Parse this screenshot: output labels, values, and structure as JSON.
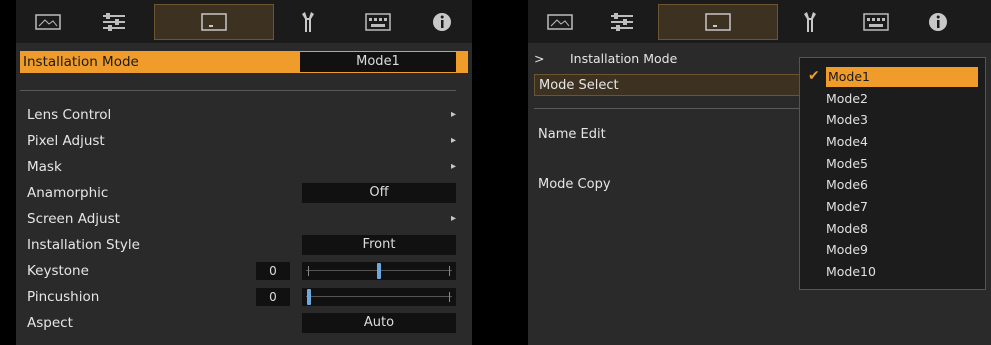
{
  "left_panel": {
    "tabs": [
      "picture-icon",
      "sliders-icon",
      "screen-icon",
      "wrench-icon",
      "keyboard-icon",
      "info-icon"
    ],
    "active_tab": 2,
    "header": {
      "label": "Installation Mode",
      "value": "Mode1"
    },
    "rows": [
      {
        "label": "Lens Control",
        "arrow": "▸"
      },
      {
        "label": "Pixel Adjust",
        "arrow": "▸"
      },
      {
        "label": "Mask",
        "arrow": "▸"
      },
      {
        "label": "Anamorphic",
        "value": "Off"
      },
      {
        "label": "Screen Adjust",
        "arrow": "▸"
      },
      {
        "label": "Installation Style",
        "value": "Front"
      },
      {
        "label": "Keystone",
        "number": "0",
        "slider_level": 0.5
      },
      {
        "label": "Pincushion",
        "number": "0",
        "slider_level": 0.0
      },
      {
        "label": "Aspect",
        "value": "Auto"
      }
    ]
  },
  "right_panel": {
    "active_tab": 2,
    "breadcrumb": {
      "prefix": ">",
      "title": "Installation Mode"
    },
    "rows": [
      {
        "label": "Mode Select"
      },
      {
        "label": "Name Edit"
      },
      {
        "label": "Mode Copy"
      }
    ],
    "dropdown": {
      "check": "✔",
      "selected_index": 0,
      "options": [
        "Mode1",
        "Mode2",
        "Mode3",
        "Mode4",
        "Mode5",
        "Mode6",
        "Mode7",
        "Mode8",
        "Mode9",
        "Mode10"
      ]
    }
  },
  "colors": {
    "accent": "#f09c2a",
    "panel": "#2a2a2a",
    "tabbar": "#1b1b1b",
    "slider_thumb": "#6fa8dc"
  }
}
